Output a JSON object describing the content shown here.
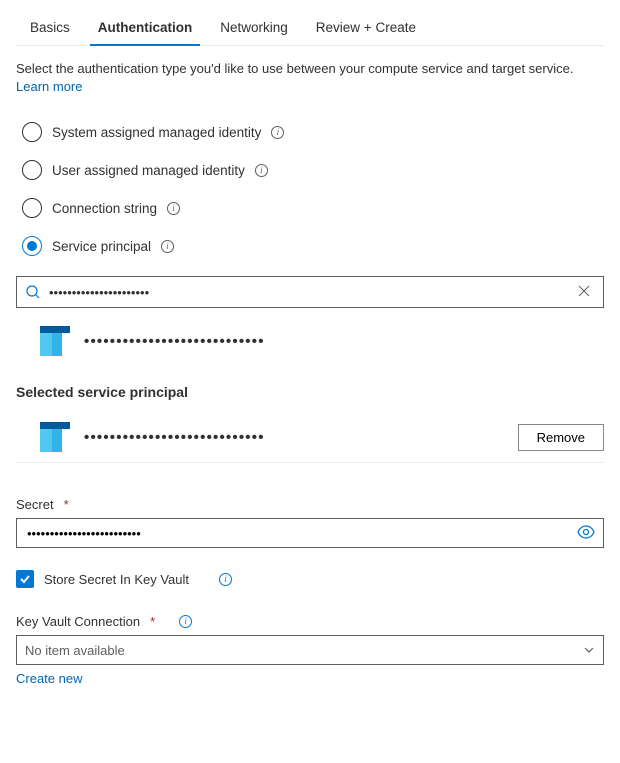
{
  "tabs": {
    "basics": "Basics",
    "auth": "Authentication",
    "networking": "Networking",
    "review": "Review + Create"
  },
  "intro": {
    "text": "Select the authentication type you'd like to use between your compute service and target service. ",
    "link": "Learn more"
  },
  "authOptions": {
    "sysIdentity": "System assigned managed identity",
    "userIdentity": "User assigned managed identity",
    "connString": "Connection string",
    "servicePrincipal": "Service principal"
  },
  "search": {
    "value": "••••••••••••••••••••••",
    "resultLabel": "••••••••••••••••••••••••••••"
  },
  "selectedPrincipal": {
    "header": "Selected service principal",
    "label": "••••••••••••••••••••••••••••",
    "removeBtn": "Remove"
  },
  "secret": {
    "label": "Secret",
    "value": "•••••••••••••••••••••••••"
  },
  "storeKV": {
    "label": "Store Secret In Key Vault"
  },
  "kvConn": {
    "label": "Key Vault Connection",
    "selected": "No item available",
    "createNew": "Create new"
  }
}
